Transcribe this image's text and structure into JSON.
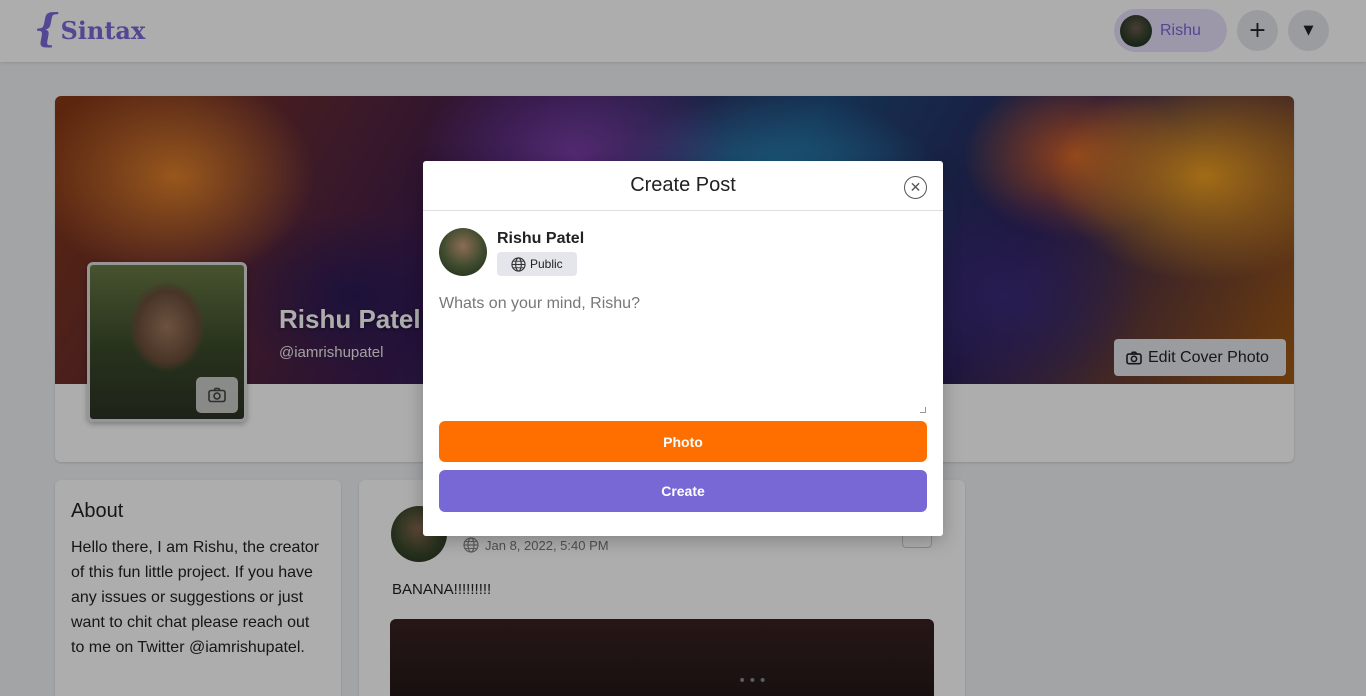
{
  "app": {
    "logo_mark": "{",
    "logo_text": "Sintax"
  },
  "header": {
    "user_name": "Rishu",
    "add_icon": "+",
    "menu_icon": "▼"
  },
  "profile": {
    "name": "Rishu Patel",
    "handle": "@iamrishupatel",
    "edit_cover_label": "Edit Cover Photo"
  },
  "about": {
    "title": "About",
    "text": "Hello there, I am Rishu, the creator of this fun little project. If you have any issues or suggestions or just want to chit chat please reach out to me on Twitter @iamrishupatel."
  },
  "post": {
    "timestamp": "Jan 8, 2022, 5:40 PM",
    "text": "BANANA!!!!!!!!!",
    "image_dots": "•••"
  },
  "modal": {
    "title": "Create Post",
    "close_icon": "✕",
    "author_name": "Rishu Patel",
    "privacy_label": "Public",
    "textarea_placeholder": "Whats on your mind, Rishu?",
    "photo_button_label": "Photo",
    "create_button_label": "Create"
  },
  "colors": {
    "brand": "#7b68d9",
    "photo_button": "#ff6f00",
    "create_button": "#7868d6"
  },
  "icons": {
    "camera": "camera-icon",
    "globe": "globe-icon",
    "close": "close-icon",
    "add": "add-icon",
    "dropdown": "chevron-down-icon"
  }
}
